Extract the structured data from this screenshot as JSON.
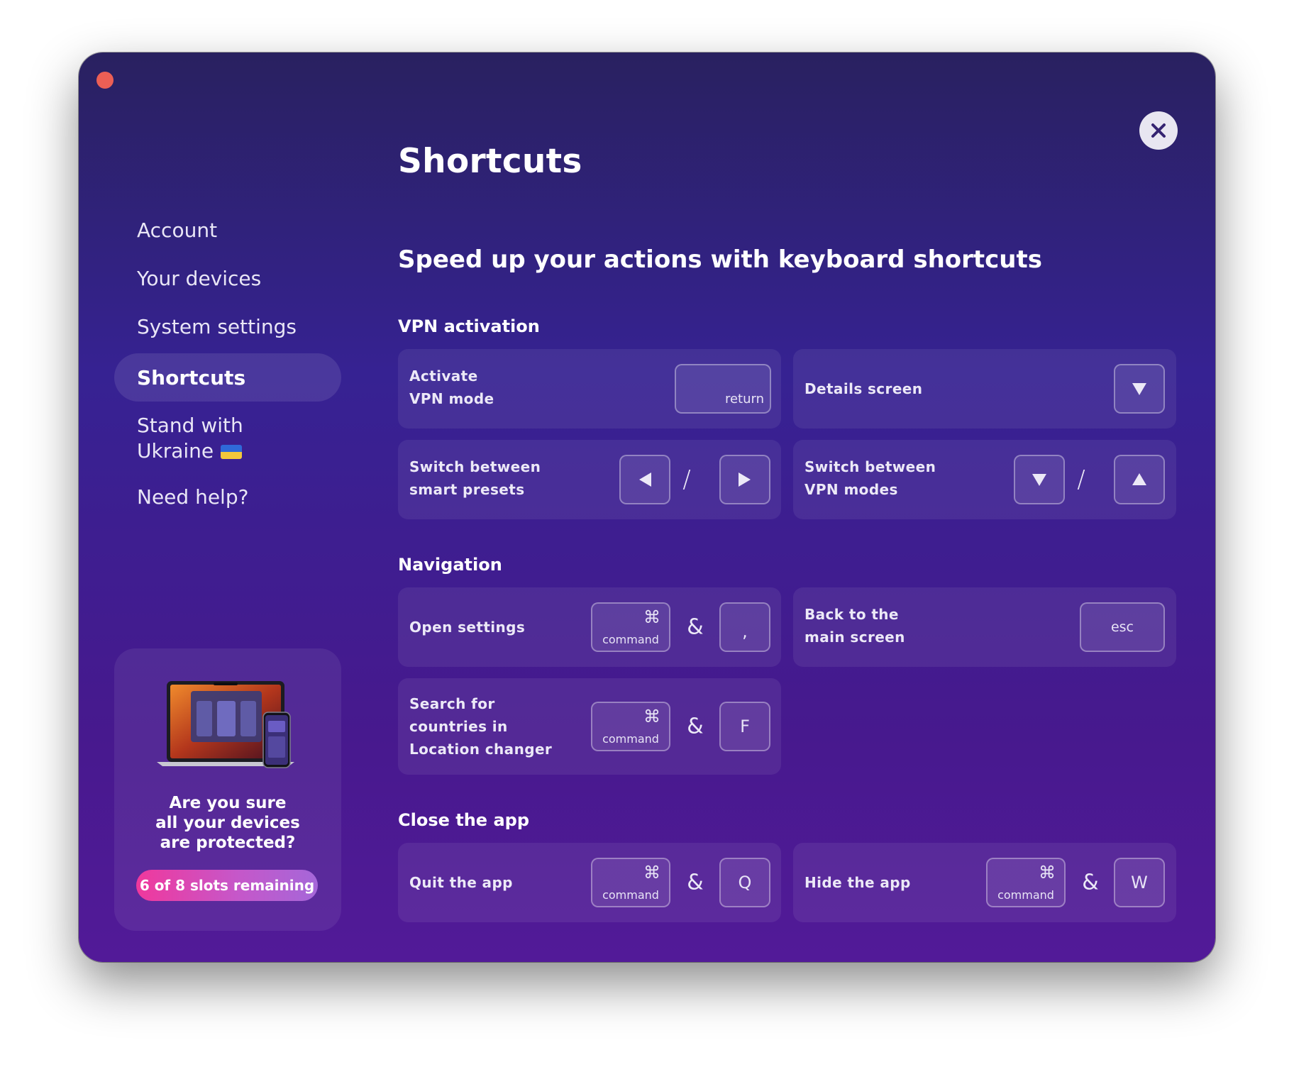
{
  "window": {
    "close_icon": "close-icon",
    "traffic_light_color": "#ec5f55"
  },
  "page_title": "Shortcuts",
  "sidebar": {
    "items": [
      {
        "label": "Account",
        "active": false
      },
      {
        "label": "Your devices",
        "active": false
      },
      {
        "label": "System settings",
        "active": false
      },
      {
        "label": "Shortcuts",
        "active": true
      },
      {
        "label_line1": "Stand with",
        "label_line2": "Ukraine",
        "icon": "ukraine-flag-icon",
        "active": false
      },
      {
        "label": "Need help?",
        "active": false
      }
    ]
  },
  "promo": {
    "line1": "Are you sure",
    "line2": "all your devices",
    "line3": "are protected?",
    "badge": "6 of 8 slots remaining"
  },
  "main": {
    "subtitle": "Speed up your actions with keyboard shortcuts",
    "sections": {
      "vpn": {
        "heading": "VPN activation",
        "activate": {
          "line1": "Activate",
          "line2": "VPN mode",
          "key": "return"
        },
        "details": {
          "label": "Details screen",
          "key_icon": "arrow-down-icon"
        },
        "presets": {
          "line1": "Switch between",
          "line2": "smart presets",
          "separator": "/",
          "keys": [
            "arrow-left-icon",
            "arrow-right-icon"
          ]
        },
        "modes": {
          "line1": "Switch between",
          "line2": "VPN modes",
          "separator": "/",
          "keys": [
            "arrow-down-icon",
            "arrow-up-icon"
          ]
        }
      },
      "navigation": {
        "heading": "Navigation",
        "open_settings": {
          "label": "Open settings",
          "cmd_glyph": "⌘",
          "cmd_text": "command",
          "amp": "&",
          "key": ","
        },
        "back": {
          "line1": "Back to the",
          "line2": "main screen",
          "key": "esc"
        },
        "search": {
          "line1": "Search for",
          "line2": "countries in",
          "line3": "Location changer",
          "cmd_glyph": "⌘",
          "cmd_text": "command",
          "amp": "&",
          "key": "F"
        }
      },
      "close": {
        "heading": "Close the app",
        "quit": {
          "label": "Quit the app",
          "cmd_glyph": "⌘",
          "cmd_text": "command",
          "amp": "&",
          "key": "Q"
        },
        "hide": {
          "label": "Hide the app",
          "cmd_glyph": "⌘",
          "cmd_text": "command",
          "amp": "&",
          "key": "W"
        }
      }
    }
  },
  "colors": {
    "background_top": "#292160",
    "background_bottom": "#521a98",
    "badge_gradient_start": "#f0389c",
    "badge_gradient_end": "#a567d9"
  }
}
